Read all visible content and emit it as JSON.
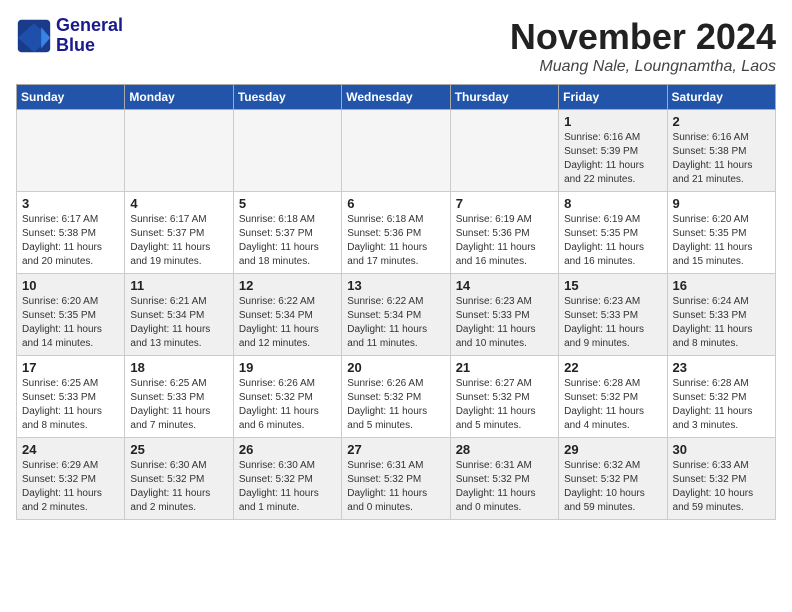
{
  "logo": {
    "line1": "General",
    "line2": "Blue"
  },
  "title": "November 2024",
  "location": "Muang Nale, Loungnamtha, Laos",
  "weekdays": [
    "Sunday",
    "Monday",
    "Tuesday",
    "Wednesday",
    "Thursday",
    "Friday",
    "Saturday"
  ],
  "weeks": [
    [
      {
        "day": "",
        "info": ""
      },
      {
        "day": "",
        "info": ""
      },
      {
        "day": "",
        "info": ""
      },
      {
        "day": "",
        "info": ""
      },
      {
        "day": "",
        "info": ""
      },
      {
        "day": "1",
        "info": "Sunrise: 6:16 AM\nSunset: 5:39 PM\nDaylight: 11 hours\nand 22 minutes."
      },
      {
        "day": "2",
        "info": "Sunrise: 6:16 AM\nSunset: 5:38 PM\nDaylight: 11 hours\nand 21 minutes."
      }
    ],
    [
      {
        "day": "3",
        "info": "Sunrise: 6:17 AM\nSunset: 5:38 PM\nDaylight: 11 hours\nand 20 minutes."
      },
      {
        "day": "4",
        "info": "Sunrise: 6:17 AM\nSunset: 5:37 PM\nDaylight: 11 hours\nand 19 minutes."
      },
      {
        "day": "5",
        "info": "Sunrise: 6:18 AM\nSunset: 5:37 PM\nDaylight: 11 hours\nand 18 minutes."
      },
      {
        "day": "6",
        "info": "Sunrise: 6:18 AM\nSunset: 5:36 PM\nDaylight: 11 hours\nand 17 minutes."
      },
      {
        "day": "7",
        "info": "Sunrise: 6:19 AM\nSunset: 5:36 PM\nDaylight: 11 hours\nand 16 minutes."
      },
      {
        "day": "8",
        "info": "Sunrise: 6:19 AM\nSunset: 5:35 PM\nDaylight: 11 hours\nand 16 minutes."
      },
      {
        "day": "9",
        "info": "Sunrise: 6:20 AM\nSunset: 5:35 PM\nDaylight: 11 hours\nand 15 minutes."
      }
    ],
    [
      {
        "day": "10",
        "info": "Sunrise: 6:20 AM\nSunset: 5:35 PM\nDaylight: 11 hours\nand 14 minutes."
      },
      {
        "day": "11",
        "info": "Sunrise: 6:21 AM\nSunset: 5:34 PM\nDaylight: 11 hours\nand 13 minutes."
      },
      {
        "day": "12",
        "info": "Sunrise: 6:22 AM\nSunset: 5:34 PM\nDaylight: 11 hours\nand 12 minutes."
      },
      {
        "day": "13",
        "info": "Sunrise: 6:22 AM\nSunset: 5:34 PM\nDaylight: 11 hours\nand 11 minutes."
      },
      {
        "day": "14",
        "info": "Sunrise: 6:23 AM\nSunset: 5:33 PM\nDaylight: 11 hours\nand 10 minutes."
      },
      {
        "day": "15",
        "info": "Sunrise: 6:23 AM\nSunset: 5:33 PM\nDaylight: 11 hours\nand 9 minutes."
      },
      {
        "day": "16",
        "info": "Sunrise: 6:24 AM\nSunset: 5:33 PM\nDaylight: 11 hours\nand 8 minutes."
      }
    ],
    [
      {
        "day": "17",
        "info": "Sunrise: 6:25 AM\nSunset: 5:33 PM\nDaylight: 11 hours\nand 8 minutes."
      },
      {
        "day": "18",
        "info": "Sunrise: 6:25 AM\nSunset: 5:33 PM\nDaylight: 11 hours\nand 7 minutes."
      },
      {
        "day": "19",
        "info": "Sunrise: 6:26 AM\nSunset: 5:32 PM\nDaylight: 11 hours\nand 6 minutes."
      },
      {
        "day": "20",
        "info": "Sunrise: 6:26 AM\nSunset: 5:32 PM\nDaylight: 11 hours\nand 5 minutes."
      },
      {
        "day": "21",
        "info": "Sunrise: 6:27 AM\nSunset: 5:32 PM\nDaylight: 11 hours\nand 5 minutes."
      },
      {
        "day": "22",
        "info": "Sunrise: 6:28 AM\nSunset: 5:32 PM\nDaylight: 11 hours\nand 4 minutes."
      },
      {
        "day": "23",
        "info": "Sunrise: 6:28 AM\nSunset: 5:32 PM\nDaylight: 11 hours\nand 3 minutes."
      }
    ],
    [
      {
        "day": "24",
        "info": "Sunrise: 6:29 AM\nSunset: 5:32 PM\nDaylight: 11 hours\nand 2 minutes."
      },
      {
        "day": "25",
        "info": "Sunrise: 6:30 AM\nSunset: 5:32 PM\nDaylight: 11 hours\nand 2 minutes."
      },
      {
        "day": "26",
        "info": "Sunrise: 6:30 AM\nSunset: 5:32 PM\nDaylight: 11 hours\nand 1 minute."
      },
      {
        "day": "27",
        "info": "Sunrise: 6:31 AM\nSunset: 5:32 PM\nDaylight: 11 hours\nand 0 minutes."
      },
      {
        "day": "28",
        "info": "Sunrise: 6:31 AM\nSunset: 5:32 PM\nDaylight: 11 hours\nand 0 minutes."
      },
      {
        "day": "29",
        "info": "Sunrise: 6:32 AM\nSunset: 5:32 PM\nDaylight: 10 hours\nand 59 minutes."
      },
      {
        "day": "30",
        "info": "Sunrise: 6:33 AM\nSunset: 5:32 PM\nDaylight: 10 hours\nand 59 minutes."
      }
    ]
  ]
}
